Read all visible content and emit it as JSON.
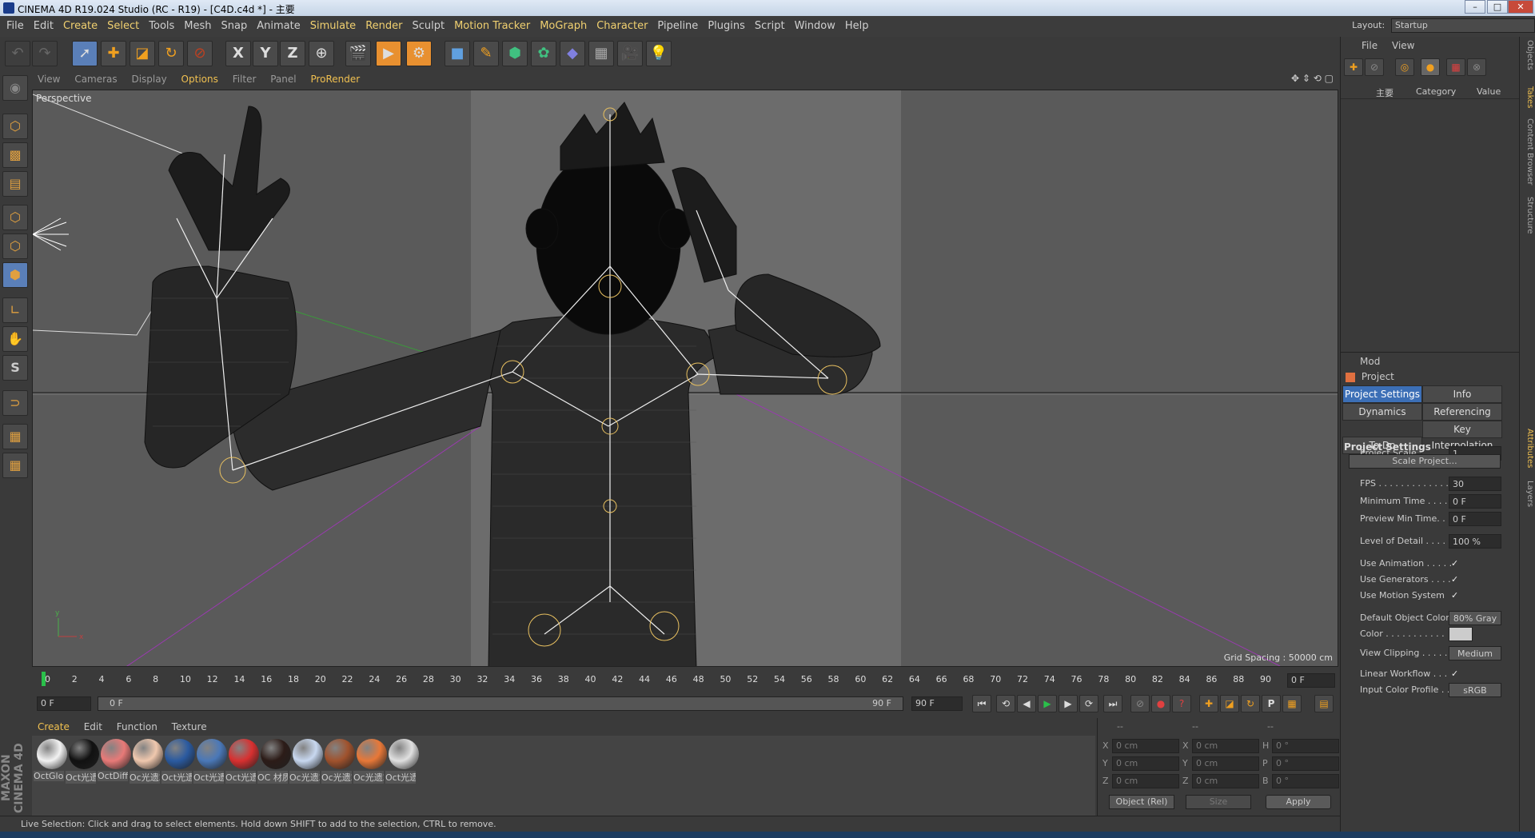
{
  "window": {
    "title": "CINEMA 4D R19.024 Studio (RC - R19) - [C4D.c4d *] - 主要"
  },
  "menubar": {
    "items": [
      "File",
      "Edit",
      "Create",
      "Select",
      "Tools",
      "Mesh",
      "Snap",
      "Animate",
      "Simulate",
      "Render",
      "Sculpt",
      "Motion Tracker",
      "MoGraph",
      "Character",
      "Pipeline",
      "Plugins",
      "Script",
      "Window",
      "Help"
    ],
    "layout_label": "Layout:",
    "layout_value": "Startup"
  },
  "toolbar": {
    "icons": [
      "undo-icon",
      "redo-icon",
      "live-selection-icon",
      "move-icon",
      "scale-icon",
      "rotate-icon",
      "recent-tool-icon",
      "x-axis-icon",
      "y-axis-icon",
      "z-axis-icon",
      "world-coordinate-icon",
      "render-view-icon",
      "render-picture-viewer-icon",
      "render-settings-icon",
      "cube-icon",
      "pen-icon",
      "subdivision-icon",
      "cloner-icon",
      "deformer-icon",
      "floor-icon",
      "camera-icon",
      "light-icon"
    ]
  },
  "viewport": {
    "menu": [
      "View",
      "Cameras",
      "Display",
      "Options",
      "Filter",
      "Panel",
      "ProRender"
    ],
    "label": "Perspective",
    "grid_spacing": "Grid Spacing : 50000 cm"
  },
  "timeline": {
    "ticks": [
      "0",
      "2",
      "4",
      "6",
      "8",
      "10",
      "12",
      "14",
      "16",
      "18",
      "20",
      "22",
      "24",
      "26",
      "28",
      "30",
      "32",
      "34",
      "36",
      "38",
      "40",
      "42",
      "44",
      "46",
      "48",
      "50",
      "52",
      "54",
      "56",
      "58",
      "60",
      "62",
      "64",
      "66",
      "68",
      "70",
      "72",
      "74",
      "76",
      "78",
      "80",
      "82",
      "84",
      "86",
      "88",
      "90"
    ],
    "current_frame": "0 F",
    "start": "0 F",
    "range_start": "0 F",
    "range_end": "90 F",
    "end": "90 F"
  },
  "materials": {
    "menu": [
      "Create",
      "Edit",
      "Function",
      "Texture"
    ],
    "items": [
      {
        "label": "OctGlos",
        "color": "#f2f2f2"
      },
      {
        "label": "Oct光遗",
        "color": "#111111"
      },
      {
        "label": "OctDiffi",
        "color": "#e87a78"
      },
      {
        "label": "Oc光遗2",
        "color": "#f0c8ae"
      },
      {
        "label": "Oct光遗",
        "color": "#2a5aa0"
      },
      {
        "label": "Oct光遗",
        "color": "#4a78b8"
      },
      {
        "label": "Oct光遗",
        "color": "#d83030"
      },
      {
        "label": "OC 材质",
        "color": "#2c1c18"
      },
      {
        "label": "Oc光遗2",
        "color": "#c8d8f0"
      },
      {
        "label": "Oc光遗2",
        "color": "#a0522d"
      },
      {
        "label": "Oc光遗2",
        "color": "#e87838"
      },
      {
        "label": "Oct光遗",
        "color": "#e0e0e0"
      }
    ]
  },
  "coords": {
    "headers": [
      "--",
      "--",
      "--"
    ],
    "rows": [
      {
        "a": "X",
        "av": "0 cm",
        "b": "X",
        "bv": "0 cm",
        "c": "H",
        "cv": "0 °"
      },
      {
        "a": "Y",
        "av": "0 cm",
        "b": "Y",
        "bv": "0 cm",
        "c": "P",
        "cv": "0 °"
      },
      {
        "a": "Z",
        "av": "0 cm",
        "b": "Z",
        "bv": "0 cm",
        "c": "B",
        "cv": "0 °"
      }
    ],
    "mode": "Object (Rel)",
    "size": "Size",
    "apply": "Apply"
  },
  "status": {
    "text": "Live Selection: Click and drag to select elements. Hold down SHIFT to add to the selection, CTRL to remove."
  },
  "objects_panel": {
    "menu": [
      "File",
      "View"
    ],
    "tree_item": "主要",
    "col_category": "Category",
    "col_value": "Value"
  },
  "attributes": {
    "mode": "Mod",
    "title": "Project",
    "tabs": [
      "Project Settings",
      "Info",
      "Dynamics",
      "Referencing",
      "To Do",
      "Key Interpolation"
    ],
    "section": "Project Settings",
    "rows": [
      {
        "label": "Project Scale . . . . . . .",
        "value": "1"
      },
      {
        "label": "FPS . . . . . . . . . . . . . .",
        "value": "30"
      },
      {
        "label": "Minimum Time . . . .",
        "value": "0 F"
      },
      {
        "label": "Preview Min Time. . .",
        "value": "0 F"
      },
      {
        "label": "Level of Detail . . . . .",
        "value": "100 %"
      },
      {
        "label": "Use Animation . . . . .",
        "value": "✓"
      },
      {
        "label": "Use Generators . . . .",
        "value": "✓"
      },
      {
        "label": "Use Motion System",
        "value": "✓"
      },
      {
        "label": "Default Object Color",
        "value": "80% Gray"
      },
      {
        "label": "Color . . . . . . . . . . .",
        "value": ""
      },
      {
        "label": "View Clipping . . . . .",
        "value": "Medium"
      },
      {
        "label": "Linear Workflow . . .",
        "value": "✓"
      },
      {
        "label": "Input Color Profile . .",
        "value": "sRGB"
      }
    ],
    "scale_button": "Scale Project..."
  },
  "side_tabs": [
    "Objects",
    "Takes",
    "Content Browser",
    "Structure",
    "Attributes",
    "Layers"
  ],
  "brand": "MAXON CINEMA 4D"
}
